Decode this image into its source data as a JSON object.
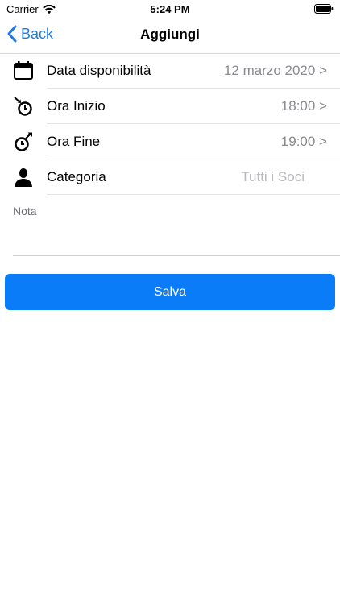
{
  "status_bar": {
    "carrier": "Carrier",
    "time": "5:24 PM"
  },
  "nav": {
    "back_label": "Back",
    "title": "Aggiungi"
  },
  "form": {
    "rows": [
      {
        "icon": "calendar-icon",
        "label": "Data disponibilità",
        "value": "12 marzo 2020 >"
      },
      {
        "icon": "timer-start-icon",
        "label": "Ora Inizio",
        "value": "18:00 >"
      },
      {
        "icon": "timer-end-icon",
        "label": "Ora Fine",
        "value": "19:00 >"
      },
      {
        "icon": "person-icon",
        "label": "Categoria",
        "placeholder": "Tutti i Soci"
      }
    ],
    "note_label": "Nota"
  },
  "save_label": "Salva",
  "colors": {
    "accent": "#0a7cf7",
    "back_link": "#1f7ae0",
    "value_text": "#8a8a8e",
    "placeholder_text": "#b9b9bd"
  }
}
